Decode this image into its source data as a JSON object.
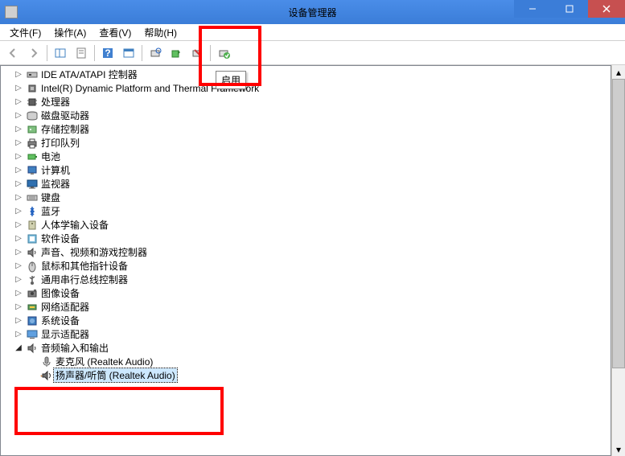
{
  "window": {
    "title": "设备管理器"
  },
  "menu": {
    "file": "文件(F)",
    "action": "操作(A)",
    "view": "查看(V)",
    "help": "帮助(H)"
  },
  "tooltip": "启用",
  "tree": {
    "items": [
      {
        "label": "IDE ATA/ATAPI 控制器",
        "icon": "ide"
      },
      {
        "label": "Intel(R) Dynamic Platform and Thermal Framework",
        "icon": "chip"
      },
      {
        "label": "处理器",
        "icon": "cpu"
      },
      {
        "label": "磁盘驱动器",
        "icon": "disk"
      },
      {
        "label": "存储控制器",
        "icon": "storage"
      },
      {
        "label": "打印队列",
        "icon": "printer"
      },
      {
        "label": "电池",
        "icon": "battery"
      },
      {
        "label": "计算机",
        "icon": "computer"
      },
      {
        "label": "监视器",
        "icon": "monitor"
      },
      {
        "label": "键盘",
        "icon": "keyboard"
      },
      {
        "label": "蓝牙",
        "icon": "bluetooth"
      },
      {
        "label": "人体学输入设备",
        "icon": "hid"
      },
      {
        "label": "软件设备",
        "icon": "software"
      },
      {
        "label": "声音、视频和游戏控制器",
        "icon": "sound"
      },
      {
        "label": "鼠标和其他指针设备",
        "icon": "mouse"
      },
      {
        "label": "通用串行总线控制器",
        "icon": "usb"
      },
      {
        "label": "图像设备",
        "icon": "camera"
      },
      {
        "label": "网络适配器",
        "icon": "nic"
      },
      {
        "label": "系统设备",
        "icon": "system"
      },
      {
        "label": "显示适配器",
        "icon": "display"
      }
    ],
    "audioNode": {
      "label": "音频输入和输出",
      "icon": "speaker"
    },
    "audioChildren": [
      {
        "label": "麦克风 (Realtek Audio)",
        "icon": "mic"
      },
      {
        "label": "扬声器/听筒 (Realtek Audio)",
        "icon": "speaker2",
        "selected": true
      }
    ]
  }
}
